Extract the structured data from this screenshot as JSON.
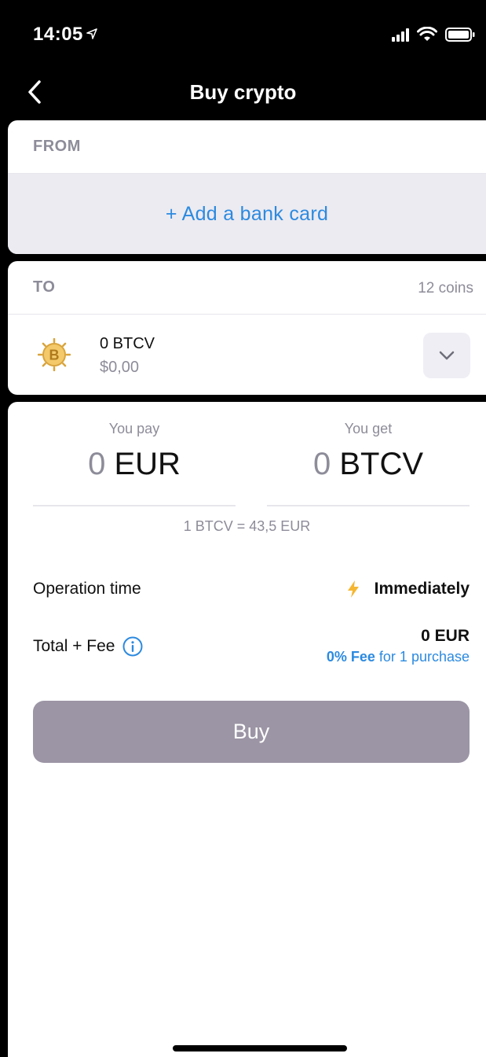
{
  "status_bar": {
    "time": "14:05"
  },
  "nav": {
    "title": "Buy crypto"
  },
  "from_section": {
    "label": "FROM",
    "add_card": "+ Add a bank card"
  },
  "to_section": {
    "label": "TO",
    "coins_count": "12 coins",
    "coin": {
      "icon": "bitcoin-vault-coin-icon",
      "amount": "0 BTCV",
      "fiat": "$0,00"
    }
  },
  "exchange": {
    "pay": {
      "label": "You pay",
      "amount": "0",
      "currency": "EUR"
    },
    "get": {
      "label": "You get",
      "amount": "0",
      "currency": "BTCV"
    },
    "rate": "1 BTCV = 43,5 EUR"
  },
  "operation_time": {
    "label": "Operation time",
    "value": "Immediately",
    "icon": "lightning-icon"
  },
  "total_fee": {
    "label": "Total + Fee",
    "value": "0 EUR",
    "promo_bold": "0% Fee",
    "promo_rest": " for 1 purchase"
  },
  "buy_button": "Buy",
  "colors": {
    "accent": "#2c8ae0",
    "button_disabled": "#9c95a5",
    "muted": "#8d8c99",
    "coin_gold": "#d9a43c"
  }
}
